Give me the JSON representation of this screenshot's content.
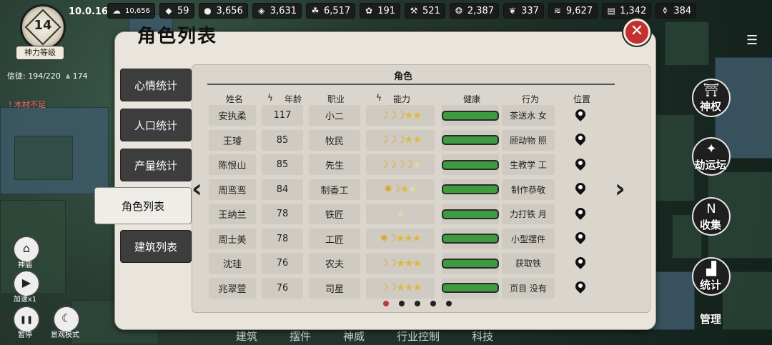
{
  "version": "10.0.16",
  "level": {
    "value": "14",
    "label": "神力等级"
  },
  "belief": {
    "text": "信徒: 194/220",
    "followers": "174"
  },
  "warning": "木材不足",
  "resources": [
    {
      "icon": "population-icon",
      "glyph": "☁",
      "value": "10,656"
    },
    {
      "icon": "food-icon",
      "glyph": "◆",
      "value": "59"
    },
    {
      "icon": "stone-icon",
      "glyph": "●",
      "value": "3,656"
    },
    {
      "icon": "ore-icon",
      "glyph": "◈",
      "value": "3,631"
    },
    {
      "icon": "grain-icon",
      "glyph": "☘",
      "value": "6,517"
    },
    {
      "icon": "livestock-icon",
      "glyph": "✿",
      "value": "191"
    },
    {
      "icon": "tool-icon",
      "glyph": "⚒",
      "value": "521"
    },
    {
      "icon": "coin-bag-icon",
      "glyph": "❂",
      "value": "2,387"
    },
    {
      "icon": "leaf-icon",
      "glyph": "❦",
      "value": "337"
    },
    {
      "icon": "herb-icon",
      "glyph": "≋",
      "value": "9,627"
    },
    {
      "icon": "chest-icon",
      "glyph": "▤",
      "value": "1,342"
    },
    {
      "icon": "bottle-icon",
      "glyph": "⚱",
      "value": "384"
    }
  ],
  "panel": {
    "title": "角色列表",
    "section_title": "角色"
  },
  "tabs": [
    {
      "label": "心情统计",
      "active": false
    },
    {
      "label": "人口统计",
      "active": false
    },
    {
      "label": "产量统计",
      "active": false
    },
    {
      "label": "角色列表",
      "active": true
    },
    {
      "label": "建筑列表",
      "active": false
    }
  ],
  "columns": {
    "name": "姓名",
    "age": "年龄",
    "job": "职业",
    "ability": "能力",
    "health": "健康",
    "action": "行为",
    "location": "位置"
  },
  "rows": [
    {
      "name": "安执柔",
      "age": "117",
      "job": "小二",
      "ability": [
        "moon",
        "moon",
        "moon",
        "star",
        "star"
      ],
      "health": 1.0,
      "action": "茶送水  女"
    },
    {
      "name": "王璿",
      "age": "85",
      "job": "牧民",
      "ability": [
        "moon",
        "moon",
        "moon",
        "star",
        "star"
      ],
      "health": 1.0,
      "action": "顾动物  照"
    },
    {
      "name": "陈恨山",
      "age": "85",
      "job": "先生",
      "ability": [
        "moon",
        "moon",
        "moon",
        "moon",
        "pale-star"
      ],
      "health": 1.0,
      "action": "生教学  工"
    },
    {
      "name": "周鸾鸾",
      "age": "84",
      "job": "制香工",
      "ability": [
        "sun",
        "moon",
        "star",
        "pale-star"
      ],
      "health": 1.0,
      "action": "制作恭敬"
    },
    {
      "name": "王纳兰",
      "age": "78",
      "job": "铁匠",
      "ability": [
        "pale-star"
      ],
      "health": 1.0,
      "action": "力打铁  月"
    },
    {
      "name": "周士美",
      "age": "78",
      "job": "工匠",
      "ability": [
        "sun",
        "moon",
        "star",
        "star",
        "star"
      ],
      "health": 1.0,
      "action": "小型摆件"
    },
    {
      "name": "沈珪",
      "age": "76",
      "job": "农夫",
      "ability": [
        "moon",
        "moon",
        "star",
        "star",
        "star"
      ],
      "health": 1.0,
      "action": "获取铁"
    },
    {
      "name": "兆翠萱",
      "age": "76",
      "job": "司星",
      "ability": [
        "moon",
        "moon",
        "star",
        "star",
        "star"
      ],
      "health": 1.0,
      "action": "页目  没有"
    }
  ],
  "pagination": {
    "pages": 5,
    "current": 1
  },
  "right_buttons": [
    {
      "label": "神权",
      "icon": "temple-icon",
      "glyph": "⛩"
    },
    {
      "label": "劫运坛",
      "icon": "altar-icon",
      "glyph": "✦"
    },
    {
      "label": "收集",
      "icon": "collect-icon",
      "glyph": "N"
    },
    {
      "label": "统计",
      "icon": "stats-icon",
      "glyph": "▟"
    },
    {
      "label": "管理",
      "icon": "manage-icon",
      "glyph": ""
    }
  ],
  "left_controls": [
    {
      "label": "神庙",
      "icon": "home-icon",
      "glyph": "⌂"
    },
    {
      "label": "加速x1",
      "icon": "play-icon",
      "glyph": "▶"
    },
    {
      "label": "暂停",
      "icon": "pause-icon",
      "glyph": "❚❚"
    },
    {
      "label": "景观模式",
      "icon": "landscape-icon",
      "glyph": "☾"
    }
  ],
  "bottom_nav": [
    "建筑",
    "摆件",
    "神威",
    "行业控制",
    "科技"
  ]
}
